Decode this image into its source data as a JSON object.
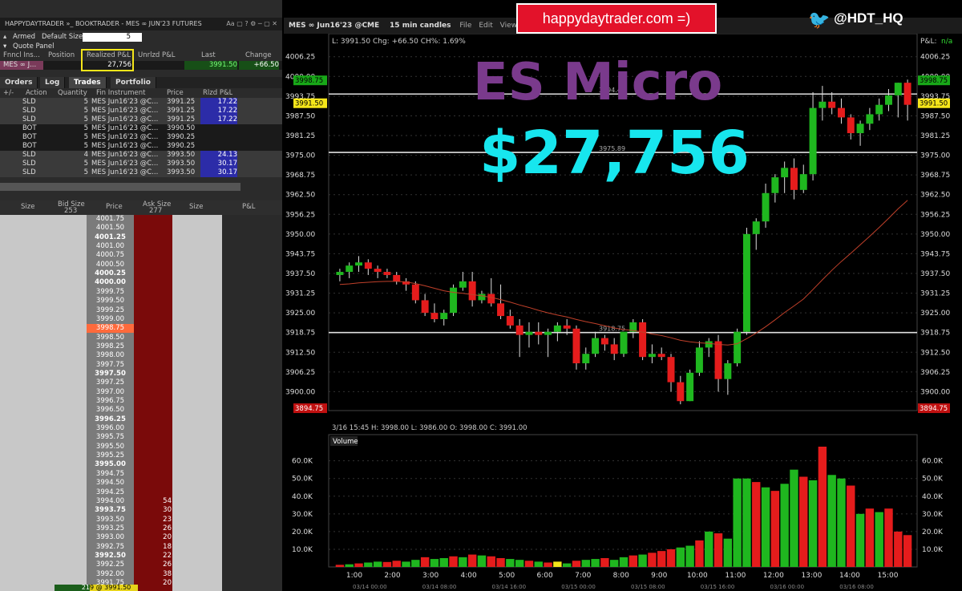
{
  "banner": "happydaytrader.com =)",
  "twitter_handle": "@HDT_HQ",
  "overlay": {
    "title": "ES Micro",
    "amount": "$27,756"
  },
  "bookwin": {
    "title": "HAPPYDAYTRADER »_ BOOKTRADER - MES ∞ JUN'23 FUTURES",
    "armed_label": "Armed",
    "default_size_label": "Default Size",
    "default_size_value": "5",
    "quote_panel_label": "Quote Panel",
    "quote_headers": [
      "Fnncl Ins...",
      "Position",
      "Realized P&L",
      "Unrlzd P&L",
      "Last",
      "Change"
    ],
    "quote_row": {
      "instrument": "MES ∞ J...",
      "realized": "27,756",
      "last": "3991.50",
      "change": "+66.50"
    },
    "tabs": [
      "Orders",
      "Log",
      "Trades",
      "Portfolio"
    ],
    "trade_headers": [
      "+/-",
      "Action",
      "Quantity",
      "Fin Instrument",
      "Price",
      "Rlzd P&L"
    ],
    "trades": [
      {
        "action": "SLD",
        "qty": "5",
        "inst": "MES Jun16'23 @C...",
        "price": "3991.25",
        "pnl": "17.22",
        "style": "dark"
      },
      {
        "action": "SLD",
        "qty": "5",
        "inst": "MES Jun16'23 @C...",
        "price": "3991.25",
        "pnl": "17.22",
        "style": "dark"
      },
      {
        "action": "SLD",
        "qty": "5",
        "inst": "MES Jun16'23 @C...",
        "price": "3991.25",
        "pnl": "17.22",
        "style": "dark"
      },
      {
        "action": "BOT",
        "qty": "5",
        "inst": "MES Jun16'23 @C...",
        "price": "3990.50",
        "pnl": "",
        "style": "blk"
      },
      {
        "action": "BOT",
        "qty": "5",
        "inst": "MES Jun16'23 @C...",
        "price": "3990.25",
        "pnl": "",
        "style": "blk"
      },
      {
        "action": "BOT",
        "qty": "5",
        "inst": "MES Jun16'23 @C...",
        "price": "3990.25",
        "pnl": "",
        "style": "blk"
      },
      {
        "action": "SLD",
        "qty": "4",
        "inst": "MES Jun16'23 @C...",
        "price": "3993.50",
        "pnl": "24.13",
        "style": "dark"
      },
      {
        "action": "SLD",
        "qty": "5",
        "inst": "MES Jun16'23 @C...",
        "price": "3993.50",
        "pnl": "30.17",
        "style": "dark"
      },
      {
        "action": "SLD",
        "qty": "5",
        "inst": "MES Jun16'23 @C...",
        "price": "3993.50",
        "pnl": "30.17",
        "style": "dark"
      }
    ],
    "book_headers": {
      "size": "Size",
      "bid_size": "Bid Size",
      "bid_total": "253",
      "price": "Price",
      "ask_size": "Ask Size",
      "ask_total": "277",
      "size2": "Size",
      "pnl": "P&L"
    },
    "book_prices": [
      "4001.75",
      "4001.50",
      "4001.25",
      "4001.00",
      "4000.75",
      "4000.50",
      "4000.25",
      "4000.00",
      "3999.75",
      "3999.50",
      "3999.25",
      "3999.00",
      "3998.75",
      "3998.50",
      "3998.25",
      "3998.00",
      "3997.75",
      "3997.50",
      "3997.25",
      "3997.00",
      "3996.75",
      "3996.50",
      "3996.25",
      "3996.00",
      "3995.75",
      "3995.50",
      "3995.25",
      "3995.00",
      "3994.75",
      "3994.50",
      "3994.25",
      "3994.00",
      "3993.75",
      "3993.50",
      "3993.25",
      "3993.00",
      "3992.75",
      "3992.50",
      "3992.25",
      "3992.00",
      "3991.75"
    ],
    "ask_sizes": {
      "31": "54",
      "32": "30",
      "33": "23",
      "34": "26",
      "35": "20",
      "36": "18",
      "37": "22",
      "38": "26",
      "39": "38",
      "40": "20"
    },
    "bottom_row": {
      "left": "21",
      "mid": "9 @ 3991.50"
    }
  },
  "chart": {
    "symbol": "MES ∞ Jun16'23 @CME",
    "interval": "15 min candles",
    "menu": [
      "File",
      "Edit",
      "View"
    ],
    "info_line": "L: 3991.50 Chg: +66.50 CH%: 1.69%",
    "pnl_label": "P&L:",
    "pnl_value": "n/a",
    "ohlc_line": "3/16 15:45   H: 3998.00   L: 3986.00   O: 3998.00   C: 3991.00",
    "volume_label": "Volume",
    "price_ticks": [
      "4006.25",
      "4000.00",
      "3993.75",
      "3987.50",
      "3981.25",
      "3975.00",
      "3968.75",
      "3962.50",
      "3956.25",
      "3950.00",
      "3943.75",
      "3937.50",
      "3931.25",
      "3925.00",
      "3918.75",
      "3912.50",
      "3906.25",
      "3900.00"
    ],
    "current_price": "3991.50",
    "marker_price": "3998.75",
    "lower_marker": "3894.75",
    "hlines": [
      {
        "price": 3994.42,
        "label": "3994.42"
      },
      {
        "price": 3975.89,
        "label": "3975.89"
      },
      {
        "price": 3918.75,
        "label": "3918.75"
      }
    ],
    "volume_ticks": [
      "60.0K",
      "50.0K",
      "40.0K",
      "30.0K",
      "20.0K",
      "10.0K"
    ],
    "time_ticks": [
      "1:00",
      "2:00",
      "3:00",
      "4:00",
      "5:00",
      "6:00",
      "7:00",
      "8:00",
      "9:00",
      "10:00",
      "11:00",
      "12:00",
      "13:00",
      "14:00",
      "15:00"
    ],
    "date_ticks": [
      "03/14 00:00",
      "03/14 08:00",
      "03/14 16:00",
      "03/15 00:00",
      "03/15 08:00",
      "03/15 16:00",
      "03/16 00:00",
      "03/16 08:00"
    ],
    "colors": {
      "up": "#1fb71f",
      "down": "#e51c1c",
      "ma": "#c0402a",
      "hline": "#e0e0e0"
    }
  },
  "chart_data": {
    "type": "candlestick",
    "ylim": [
      3894,
      4010
    ],
    "candles": [
      [
        3937,
        3939,
        3935,
        3938
      ],
      [
        3938,
        3941,
        3936,
        3940
      ],
      [
        3940,
        3943,
        3938,
        3941
      ],
      [
        3941,
        3942,
        3937,
        3939
      ],
      [
        3939,
        3940,
        3936,
        3938
      ],
      [
        3938,
        3939,
        3936,
        3937
      ],
      [
        3937,
        3938,
        3934,
        3935
      ],
      [
        3935,
        3936,
        3932,
        3934
      ],
      [
        3934,
        3935,
        3928,
        3929
      ],
      [
        3929,
        3931,
        3924,
        3925
      ],
      [
        3925,
        3928,
        3922,
        3923
      ],
      [
        3923,
        3926,
        3921,
        3925
      ],
      [
        3925,
        3934,
        3924,
        3933
      ],
      [
        3933,
        3938,
        3932,
        3935
      ],
      [
        3935,
        3938,
        3927,
        3929
      ],
      [
        3929,
        3932,
        3928,
        3931
      ],
      [
        3931,
        3936,
        3927,
        3928
      ],
      [
        3928,
        3934,
        3923,
        3924
      ],
      [
        3924,
        3926,
        3920,
        3921
      ],
      [
        3921,
        3923,
        3911,
        3918
      ],
      [
        3918,
        3922,
        3914,
        3919
      ],
      [
        3919,
        3922,
        3915,
        3918
      ],
      [
        3918,
        3920,
        3911,
        3919
      ],
      [
        3919,
        3922,
        3916,
        3921
      ],
      [
        3921,
        3923,
        3918,
        3920
      ],
      [
        3920,
        3921,
        3907,
        3909
      ],
      [
        3909,
        3914,
        3907,
        3912
      ],
      [
        3912,
        3919,
        3911,
        3917
      ],
      [
        3917,
        3918,
        3913,
        3915
      ],
      [
        3915,
        3917,
        3910,
        3912
      ],
      [
        3912,
        3917,
        3911,
        3919
      ],
      [
        3919,
        3923,
        3917,
        3922
      ],
      [
        3922,
        3923,
        3910,
        3911
      ],
      [
        3911,
        3915,
        3909,
        3912
      ],
      [
        3912,
        3914,
        3910,
        3911
      ],
      [
        3911,
        3912,
        3900,
        3903
      ],
      [
        3903,
        3905,
        3896,
        3897
      ],
      [
        3897,
        3907,
        3897,
        3906
      ],
      [
        3906,
        3916,
        3905,
        3914
      ],
      [
        3914,
        3917,
        3911,
        3916
      ],
      [
        3916,
        3918,
        3900,
        3904
      ],
      [
        3904,
        3910,
        3899,
        3909
      ],
      [
        3909,
        3920,
        3908,
        3919
      ],
      [
        3919,
        3952,
        3918,
        3950
      ],
      [
        3950,
        3955,
        3945,
        3954
      ],
      [
        3954,
        3966,
        3952,
        3963
      ],
      [
        3963,
        3969,
        3960,
        3968
      ],
      [
        3968,
        3973,
        3963,
        3971
      ],
      [
        3971,
        3974,
        3961,
        3964
      ],
      [
        3964,
        3972,
        3963,
        3969
      ],
      [
        3969,
        3995,
        3967,
        3990
      ],
      [
        3990,
        3997,
        3986,
        3992
      ],
      [
        3992,
        3995,
        3988,
        3990
      ],
      [
        3990,
        3993,
        3985,
        3987
      ],
      [
        3987,
        3988,
        3980,
        3982
      ],
      [
        3982,
        3986,
        3978,
        3985
      ],
      [
        3985,
        3990,
        3983,
        3988
      ],
      [
        3988,
        3993,
        3986,
        3991
      ],
      [
        3991,
        3996,
        3989,
        3994
      ],
      [
        3994,
        3998,
        3987,
        3998
      ],
      [
        3998,
        3999,
        3986,
        3991
      ]
    ],
    "ma": [
      3934,
      3934.2,
      3934.5,
      3934.7,
      3934.9,
      3935,
      3935,
      3934.8,
      3934.3,
      3933.6,
      3932.8,
      3932,
      3931.5,
      3931.2,
      3930.8,
      3930.4,
      3929.9,
      3929.2,
      3928.4,
      3927.5,
      3926.7,
      3925.8,
      3925,
      3924.3,
      3923.7,
      3922.9,
      3922.2,
      3921.6,
      3920.9,
      3920.2,
      3919.7,
      3919.4,
      3918.9,
      3918.3,
      3917.8,
      3917.1,
      3916.3,
      3915.8,
      3915.5,
      3915.3,
      3915,
      3914.8,
      3915.2,
      3916.8,
      3918.6,
      3920.6,
      3922.8,
      3925.1,
      3927.2,
      3929.4,
      3932.4,
      3935.5,
      3938.5,
      3941.3,
      3943.9,
      3946.6,
      3949.3,
      3952.1,
      3955,
      3958,
      3960.7
    ],
    "volume_ylim": [
      0,
      68000
    ],
    "volume": [
      1200,
      1500,
      2000,
      2500,
      3000,
      2800,
      3500,
      3000,
      4000,
      5500,
      4500,
      5000,
      6000,
      5500,
      7000,
      6500,
      6000,
      5000,
      4500,
      4000,
      3500,
      3000,
      2500,
      3000,
      2000,
      3500,
      4000,
      4500,
      5000,
      4000,
      5500,
      6500,
      7000,
      8000,
      9000,
      10000,
      11000,
      12000,
      15000,
      20000,
      19000,
      16000,
      50000,
      50000,
      48000,
      45000,
      43000,
      47000,
      55000,
      51000,
      49000,
      68000,
      52000,
      50000,
      46000,
      30000,
      33000,
      31000,
      33000,
      20000,
      18000
    ],
    "volume_dir": [
      "d",
      "u",
      "d",
      "u",
      "u",
      "d",
      "d",
      "u",
      "u",
      "d",
      "u",
      "u",
      "d",
      "u",
      "d",
      "u",
      "d",
      "d",
      "u",
      "u",
      "d",
      "u",
      "d",
      "y",
      "u",
      "d",
      "u",
      "u",
      "d",
      "u",
      "u",
      "d",
      "u",
      "d",
      "d",
      "d",
      "u",
      "u",
      "d",
      "u",
      "d",
      "u",
      "u",
      "u",
      "d",
      "u",
      "d",
      "u",
      "u",
      "d",
      "u",
      "d",
      "u",
      "u",
      "d",
      "u",
      "d",
      "u",
      "d",
      "d",
      "d"
    ]
  }
}
